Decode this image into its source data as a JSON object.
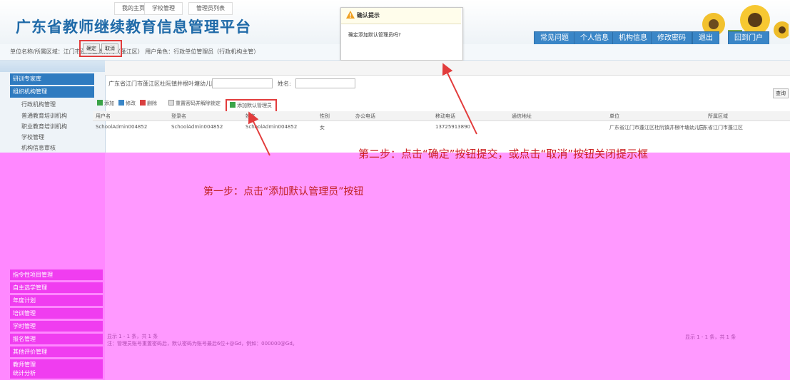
{
  "header": {
    "title": "广东省教师继续教育信息管理平台",
    "nav": [
      "常见问题",
      "个人信息",
      "机构信息",
      "修改密码",
      "退出",
      "回到门户"
    ],
    "info": "单位名称/所属区域：江门市蓬江区教育局（蓬江区）   用户角色：行政单位管理员（行政机构主管）"
  },
  "dialog": {
    "title": "确认提示",
    "message": "确定添加默认管理员吗?",
    "ok": "确定",
    "cancel": "取消"
  },
  "sidebar": {
    "sections": [
      "研训专家库",
      "组织机构管理"
    ],
    "items": [
      "行政机构管理",
      "普通教育培训机构",
      "职业教育培训机构",
      "学校管理",
      "机构信息审核"
    ],
    "bottom_sections": [
      "指令性项目管理",
      "自主选学管理",
      "年度计划",
      "培训管理",
      "学时管理",
      "报名管理",
      "其他评价管理",
      "教师管理",
      "统计分析"
    ]
  },
  "tabs": [
    "我的主页",
    "学校管理",
    "管理员列表"
  ],
  "search": {
    "school_label": "广东省江门市蓬江区杜阮镇井根叶塘幼儿园登录名:",
    "name_label": "姓名:",
    "query": "查询"
  },
  "toolbar": {
    "add": "添加",
    "edit": "修改",
    "delete": "删除",
    "reset": "重置密码并解除锁定",
    "add_default": "添加默认管理员"
  },
  "grid": {
    "columns": [
      "用户名",
      "登录名",
      "姓名",
      "性别",
      "办公电话",
      "移动电话",
      "通信地址",
      "单位",
      "所属区域"
    ],
    "rows": [
      [
        "SchoolAdmin004852",
        "SchoolAdmin004852",
        "SchoolAdmin004852",
        "女",
        "",
        "13725913890",
        "",
        "广东省江门市蓬江区杜阮镇井根叶塘幼儿园",
        "广东省江门市蓬江区"
      ]
    ]
  },
  "annotations": {
    "step1": "第一步：点击“添加默认管理员”按钮",
    "step2": "第二步：点击“确定”按钮提交，或点击“取消”按钮关闭提示框"
  },
  "footer": {
    "pager": "显示 1 - 1 条，共 1 条",
    "note": "注：管理员账号重置密码后，默认密码为账号最后6位+@Gd，例如：000000@Gd。"
  },
  "colors": {
    "title_blue": "#1f6aa8",
    "nav_blue": "#3a86c7",
    "annotation_red": "#e23c3c",
    "magenta": "#ff99ff"
  }
}
